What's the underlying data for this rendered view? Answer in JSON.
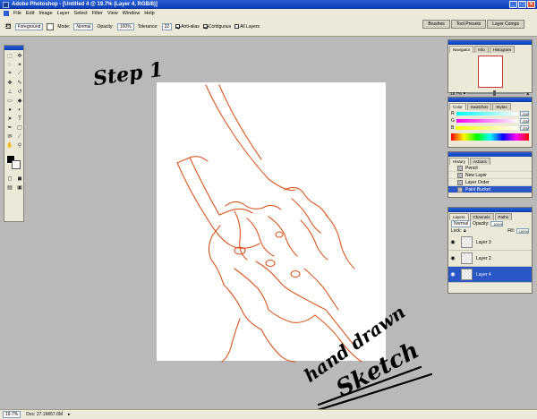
{
  "window": {
    "title": "Adobe Photoshop - [Untitled 4 @ 19.7% (Layer 4, RGB/8)]",
    "min": "_",
    "max": "□",
    "close": "×"
  },
  "menu": [
    "File",
    "Edit",
    "Image",
    "Layer",
    "Select",
    "Filter",
    "View",
    "Window",
    "Help"
  ],
  "options": {
    "fill_source": "Foreground",
    "mode_label": "Mode:",
    "mode_value": "Normal",
    "opacity_label": "Opacity:",
    "opacity_value": "100%",
    "tolerance_label": "Tolerance:",
    "tolerance_value": "32",
    "antialias": "Anti-alias",
    "contiguous": "Contiguous",
    "all_layers": "All Layers"
  },
  "well_tabs": [
    "Brushes",
    "Tool Presets",
    "Layer Comps"
  ],
  "navigator": {
    "tabs": [
      "Navigator",
      "Info",
      "Histogram"
    ],
    "zoom": "19.7%"
  },
  "color_panel": {
    "tabs": [
      "Color",
      "Swatches",
      "Styles"
    ],
    "rows": [
      {
        "label": "R",
        "value": "255",
        "color": "#ff0000"
      },
      {
        "label": "G",
        "value": "255",
        "color": "#00c000"
      },
      {
        "label": "B",
        "value": "255",
        "color": "#0000ff"
      }
    ]
  },
  "history": {
    "tabs": [
      "History",
      "Actions"
    ],
    "items": [
      "Pencil",
      "New Layer",
      "Layer Order",
      "Paint Bucket"
    ],
    "active_index": 3
  },
  "layers": {
    "tabs": [
      "Layers",
      "Channels",
      "Paths"
    ],
    "blend": "Normal",
    "opacity_label": "Opacity:",
    "opacity_value": "100%",
    "lock_label": "Lock:",
    "fill_label": "Fill:",
    "fill_value": "100%",
    "items": [
      "Layer 3",
      "Layer 2",
      "Layer 4"
    ],
    "active_index": 2
  },
  "status": {
    "zoom": "19.7%",
    "doc": "Doc: 27.1M/67.6M"
  },
  "annotations": {
    "step": "Step 1",
    "hand_drawn": "hand drawn",
    "sketch": "Sketch"
  },
  "colors": {
    "sketch_line": "#d9551e",
    "titlebar": "#0a3bb0"
  }
}
